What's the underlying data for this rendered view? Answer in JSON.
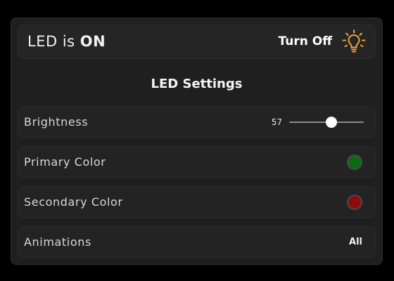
{
  "status": {
    "prefix": "LED is",
    "state": "ON",
    "toggle_label": "Turn Off",
    "icon": "lightbulb-icon",
    "icon_color": "#f0a23a"
  },
  "settings": {
    "title": "LED Settings",
    "brightness": {
      "label": "Brightness",
      "value": "57",
      "value_fraction": 0.57
    },
    "primary_color": {
      "label": "Primary Color",
      "color": "#0b6b14"
    },
    "secondary_color": {
      "label": "Secondary Color",
      "color": "#8c0b0b"
    },
    "animations": {
      "label": "Animations",
      "value": "All"
    }
  }
}
